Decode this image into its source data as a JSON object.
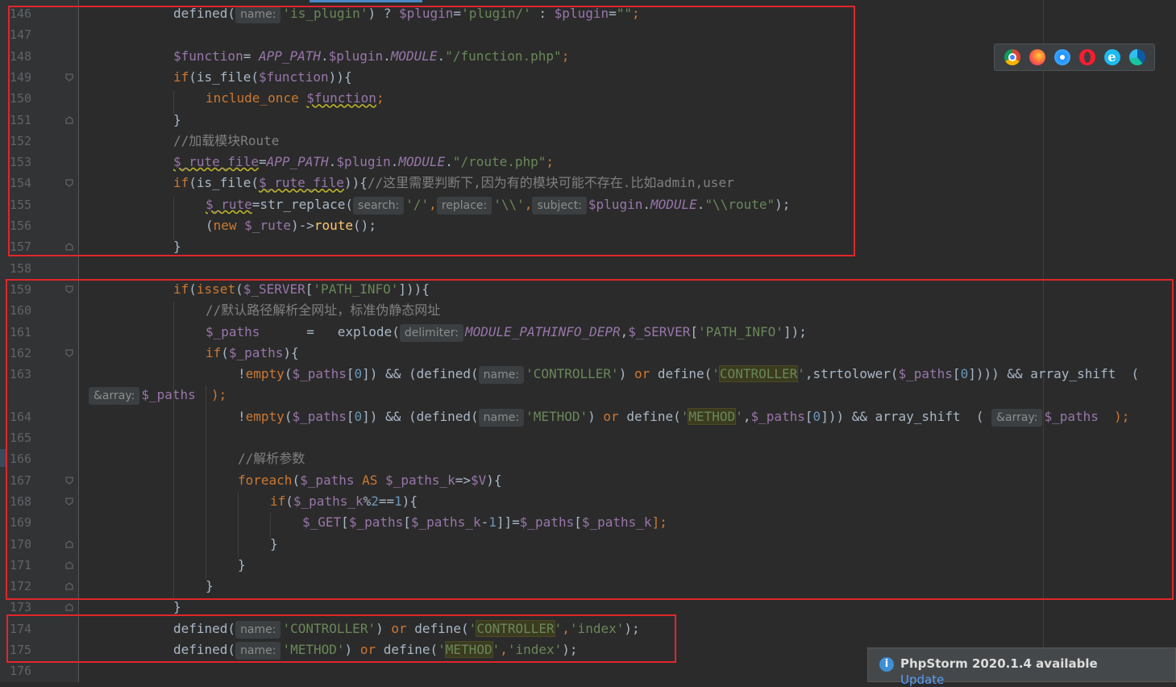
{
  "editor": {
    "lines": [
      {
        "n": "146",
        "t": [
          "defined(",
          "name:",
          "'is_plugin'",
          ") ? ",
          "$plugin",
          "=",
          "'plugin/'",
          " : ",
          "$plugin",
          "=",
          "\"\"",
          ";"
        ]
      },
      {
        "n": "147"
      },
      {
        "n": "148",
        "t": [
          "$function",
          "= ",
          "APP_PATH",
          ".",
          "$plugin",
          ".",
          "MODULE",
          ".",
          "\"/function.php\"",
          ";"
        ]
      },
      {
        "n": "149",
        "t": [
          "if",
          "(is_file(",
          "$function",
          ")){"
        ]
      },
      {
        "n": "150",
        "t": [
          "include_once ",
          "$function",
          ";"
        ]
      },
      {
        "n": "151",
        "t": [
          "}"
        ]
      },
      {
        "n": "152",
        "t": [
          "//加载模块Route"
        ]
      },
      {
        "n": "153",
        "t": [
          "$_rute_file",
          "=",
          "APP_PATH",
          ".",
          "$plugin",
          ".",
          "MODULE",
          ".",
          "\"/route.php\"",
          ";"
        ]
      },
      {
        "n": "154",
        "t": [
          "if",
          "(is_file(",
          "$_rute_file",
          ")){",
          "//这里需要判断下,因为有的模块可能不存在.比如admin,user"
        ]
      },
      {
        "n": "155",
        "t": [
          "$_rute",
          "=str_replace(",
          "search:",
          "'/'",
          ",",
          "replace:",
          "'\\\\'",
          ",",
          "subject:",
          "$plugin",
          ".",
          "MODULE",
          ".",
          "\"\\\\route\"",
          ");"
        ]
      },
      {
        "n": "156",
        "t": [
          "(",
          "new ",
          "$_rute",
          ")->",
          "route",
          "();"
        ]
      },
      {
        "n": "157",
        "t": [
          "}"
        ]
      },
      {
        "n": "158"
      },
      {
        "n": "159",
        "t": [
          "if",
          "(",
          "isset",
          "(",
          "$_SERVER",
          "[",
          "'PATH_INFO'",
          "])){"
        ]
      },
      {
        "n": "160",
        "t": [
          "//默认路径解析全网址，标准伪静态网址"
        ]
      },
      {
        "n": "161",
        "t": [
          "$_paths",
          "      =   explode(",
          "delimiter:",
          "MODULE_PATHINFO_DEPR",
          ",",
          "$_SERVER",
          "[",
          "'PATH_INFO'",
          "]);"
        ]
      },
      {
        "n": "162",
        "t": [
          "if",
          "(",
          "$_paths",
          "){"
        ]
      },
      {
        "n": "163",
        "t": [
          "!",
          "empty",
          "(",
          "$_paths",
          "[",
          "0",
          "]) && (defined(",
          "name:",
          "'CONTROLLER'",
          ") ",
          "or",
          " define(",
          "'",
          "CONTROLLER",
          "'",
          ",strtolower(",
          "$_paths",
          "[",
          "0",
          "]))) && array_shift  ("
        ]
      },
      {
        "n": "",
        "t": [
          "&array:",
          "$_paths",
          "  );"
        ]
      },
      {
        "n": "164",
        "t": [
          "!",
          "empty",
          "(",
          "$_paths",
          "[",
          "0",
          "]) && (defined(",
          "name:",
          "'METHOD'",
          ") ",
          "or",
          " define(",
          "'",
          "METHOD",
          "'",
          ",",
          "$_paths",
          "[",
          "0",
          "])) && array_shift  ( ",
          "&array:",
          "$_paths",
          "  );"
        ]
      },
      {
        "n": "165"
      },
      {
        "n": "166",
        "t": [
          "//解析参数"
        ]
      },
      {
        "n": "167",
        "t": [
          "foreach",
          "(",
          "$_paths",
          " AS ",
          "$_paths_k",
          "=>",
          "$V",
          "){"
        ]
      },
      {
        "n": "168",
        "t": [
          "if",
          "(",
          "$_paths_k",
          "%",
          "2",
          "==",
          "1",
          "){"
        ]
      },
      {
        "n": "169",
        "t": [
          "$_GET",
          "[",
          "$_paths",
          "[",
          "$_paths_k",
          "-",
          "1",
          "]]=",
          "$_paths",
          "[",
          "$_paths_k",
          "];"
        ]
      },
      {
        "n": "170",
        "t": [
          "}"
        ]
      },
      {
        "n": "171",
        "t": [
          "}"
        ]
      },
      {
        "n": "172",
        "t": [
          "}"
        ]
      },
      {
        "n": "173",
        "t": [
          "}"
        ]
      },
      {
        "n": "174",
        "t": [
          "defined(",
          "name:",
          "'CONTROLLER'",
          ") ",
          "or",
          " define(",
          "'",
          "CONTROLLER",
          "'",
          ",",
          "'index'",
          ");"
        ]
      },
      {
        "n": "175",
        "t": [
          "defined(",
          "name:",
          "'METHOD'",
          ") ",
          "or",
          " define(",
          "'",
          "METHOD",
          "'",
          ",",
          "'index'",
          ");"
        ]
      },
      {
        "n": "176"
      }
    ]
  },
  "browser_icons": [
    "chrome-icon",
    "firefox-icon",
    "safari-icon",
    "opera-icon",
    "ie-icon",
    "edge-icon"
  ],
  "notification": {
    "title": "PhpStorm 2020.1.4 available",
    "link": "Update"
  },
  "colors": {
    "background": "#2b2b2b",
    "keyword": "#cc7832",
    "string": "#6a8759",
    "variable": "#9876aa",
    "comment": "#808080",
    "highlight_box": "#e0262b"
  }
}
